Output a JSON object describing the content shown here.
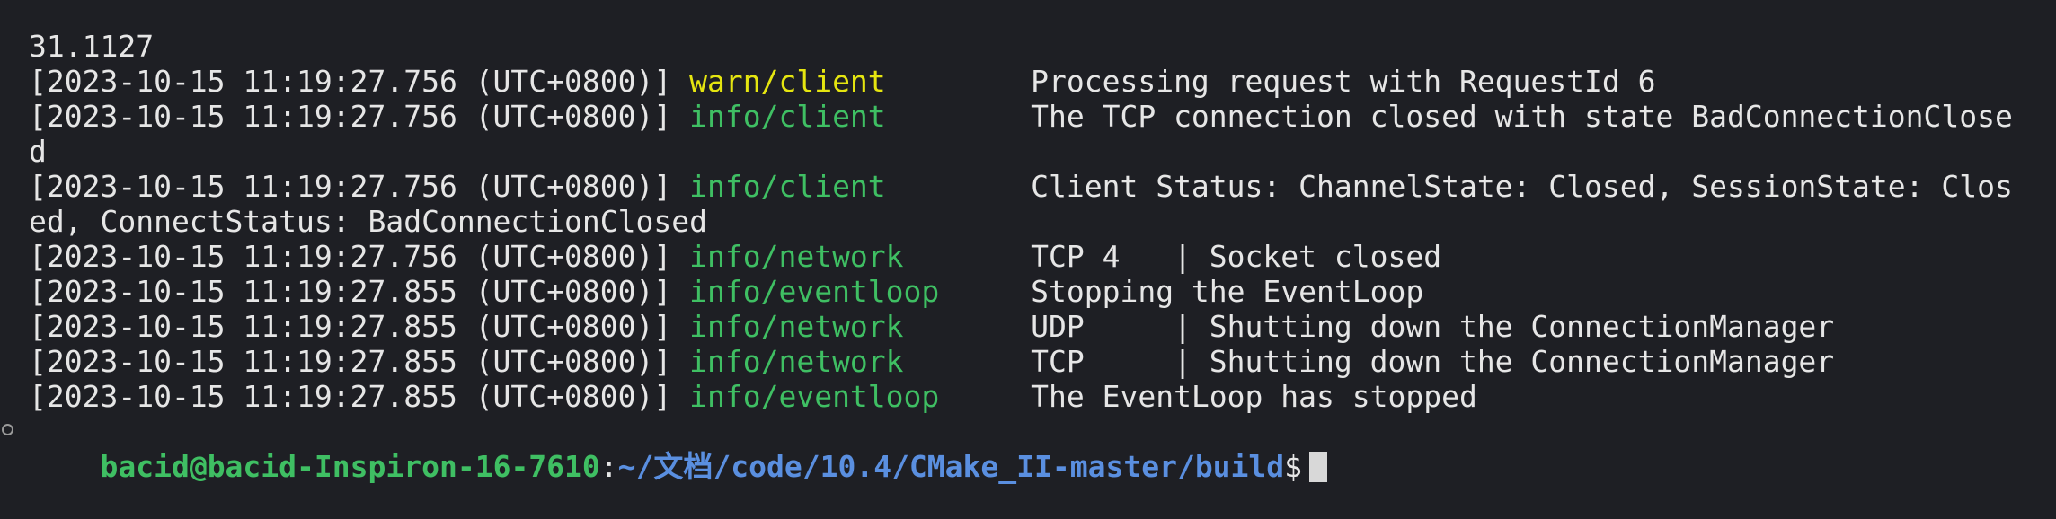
{
  "terminal": {
    "first_line": "31.1127",
    "logs": [
      {
        "ts": "[2023-10-15 11:19:27.756 (UTC+0800)]",
        "level": "warn/client",
        "kind": "warn",
        "msg": "Processing request with RequestId 6",
        "cont": ""
      },
      {
        "ts": "[2023-10-15 11:19:27.756 (UTC+0800)]",
        "level": "info/client",
        "kind": "info",
        "msg": "The TCP connection closed with state BadConnectionClose",
        "cont": "d"
      },
      {
        "ts": "[2023-10-15 11:19:27.756 (UTC+0800)]",
        "level": "info/client",
        "kind": "info",
        "msg": "Client Status: ChannelState: Closed, SessionState: Clos",
        "cont": "ed, ConnectStatus: BadConnectionClosed"
      },
      {
        "ts": "[2023-10-15 11:19:27.756 (UTC+0800)]",
        "level": "info/network",
        "kind": "info",
        "msg": "TCP 4   | Socket closed",
        "cont": ""
      },
      {
        "ts": "[2023-10-15 11:19:27.855 (UTC+0800)]",
        "level": "info/eventloop",
        "kind": "info",
        "msg": "Stopping the EventLoop",
        "cont": ""
      },
      {
        "ts": "[2023-10-15 11:19:27.855 (UTC+0800)]",
        "level": "info/network",
        "kind": "info",
        "msg": "UDP     | Shutting down the ConnectionManager",
        "cont": ""
      },
      {
        "ts": "[2023-10-15 11:19:27.855 (UTC+0800)]",
        "level": "info/network",
        "kind": "info",
        "msg": "TCP     | Shutting down the ConnectionManager",
        "cont": ""
      },
      {
        "ts": "[2023-10-15 11:19:27.855 (UTC+0800)]",
        "level": "info/eventloop",
        "kind": "info",
        "msg": "The EventLoop has stopped",
        "cont": ""
      }
    ],
    "prompt": {
      "user_host": "bacid@bacid-Inspiron-16-7610",
      "colon": ":",
      "path": "~/文档/code/10.4/CMake_II-master/build",
      "symbol": "$"
    },
    "colors": {
      "background": "#1e1f24",
      "warn": "#e5e510",
      "info": "#3fbf63",
      "path": "#5a8fe0",
      "text": "#e6e6e6"
    }
  }
}
